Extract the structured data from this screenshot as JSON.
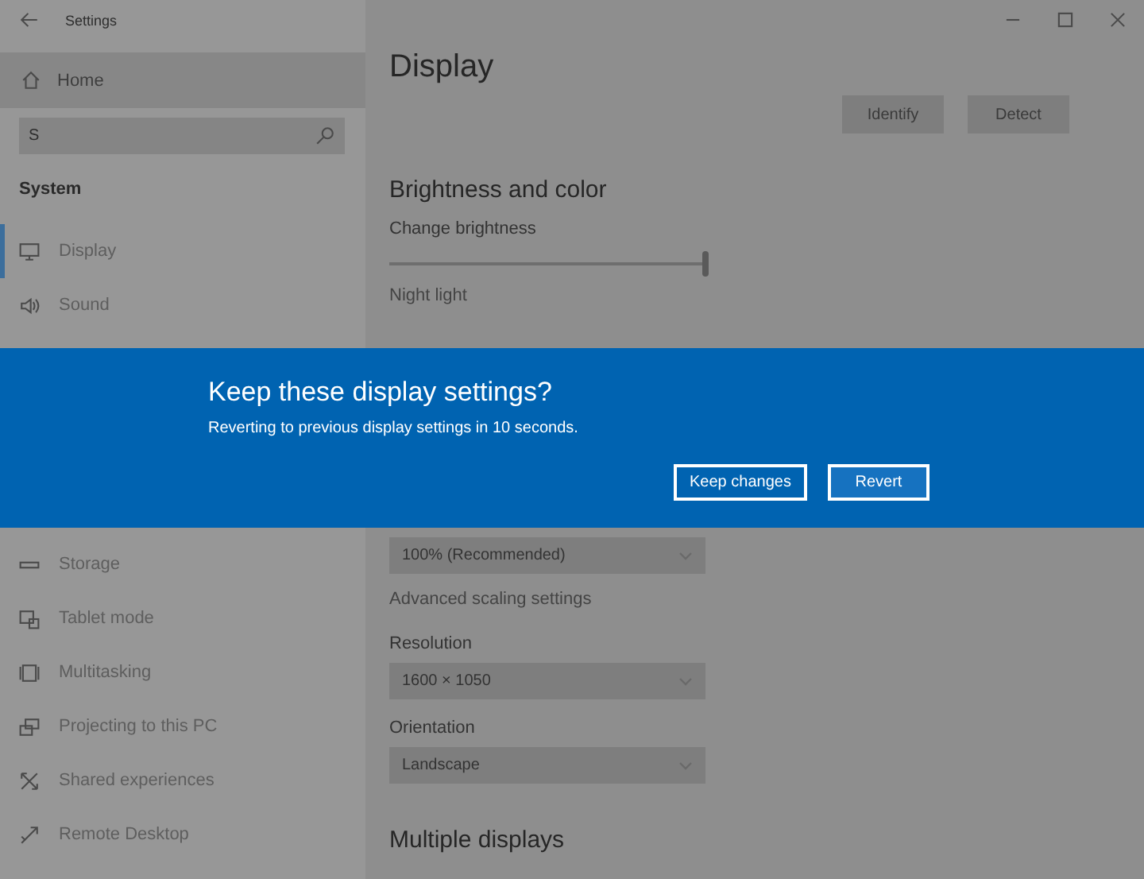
{
  "window": {
    "title": "Settings"
  },
  "sidebar": {
    "home": "Home",
    "search": {
      "value": "S"
    },
    "section": "System",
    "items_above": [
      {
        "label": "Display",
        "selected": true
      },
      {
        "label": "Sound",
        "selected": false
      }
    ],
    "items_below": [
      {
        "label": "Storage",
        "selected": false
      },
      {
        "label": "Tablet mode",
        "selected": false
      },
      {
        "label": "Multitasking",
        "selected": false
      },
      {
        "label": "Projecting to this PC",
        "selected": false
      },
      {
        "label": "Shared experiences",
        "selected": false
      },
      {
        "label": "Remote Desktop",
        "selected": false
      }
    ]
  },
  "main": {
    "title": "Display",
    "buttons": [
      "Identify",
      "Detect"
    ],
    "brightness": {
      "heading": "Brightness and color",
      "label": "Change brightness",
      "level": 1,
      "night_light": "Night light"
    },
    "scale": {
      "value": "100% (Recommended)",
      "link": "Advanced scaling settings"
    },
    "resolution": {
      "label": "Resolution",
      "value": "1600 × 1050"
    },
    "orientation": {
      "label": "Orientation",
      "value": "Landscape"
    },
    "multiple_heading": "Multiple displays"
  },
  "dialog": {
    "title": "Keep these display settings?",
    "message": "Reverting to previous display settings in 10 seconds.",
    "buttons": [
      "Keep changes",
      "Revert"
    ]
  }
}
